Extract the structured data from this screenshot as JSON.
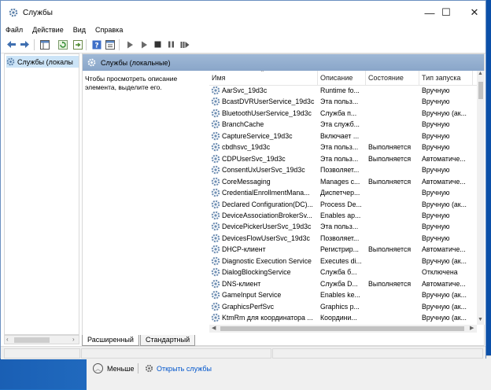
{
  "window": {
    "title": "Службы",
    "minimize": "—",
    "maximize": "☐",
    "close": "✕"
  },
  "menu": [
    "Файл",
    "Действие",
    "Вид",
    "Справка"
  ],
  "tree": {
    "node_label": "Службы (локалы"
  },
  "pane": {
    "header": "Службы (локальные)",
    "description": "Чтобы просмотреть описание элемента, выделите его.",
    "columns": {
      "name": "Имя",
      "description": "Описание",
      "status": "Состояние",
      "startup": "Тип запуска"
    }
  },
  "services": [
    {
      "name": "AarSvc_19d3c",
      "description": "Runtime fo...",
      "status": "",
      "startup": "Вручную"
    },
    {
      "name": "BcastDVRUserService_19d3c",
      "description": "Эта польз...",
      "status": "",
      "startup": "Вручную"
    },
    {
      "name": "BluetoothUserService_19d3c",
      "description": "Служба п...",
      "status": "",
      "startup": "Вручную (ак..."
    },
    {
      "name": "BranchCache",
      "description": "Эта служб...",
      "status": "",
      "startup": "Вручную"
    },
    {
      "name": "CaptureService_19d3c",
      "description": "Включает ...",
      "status": "",
      "startup": "Вручную"
    },
    {
      "name": "cbdhsvc_19d3c",
      "description": "Эта польз...",
      "status": "Выполняется",
      "startup": "Вручную"
    },
    {
      "name": "CDPUserSvc_19d3c",
      "description": "Эта польз...",
      "status": "Выполняется",
      "startup": "Автоматиче..."
    },
    {
      "name": "ConsentUxUserSvc_19d3c",
      "description": "Позволяет...",
      "status": "",
      "startup": "Вручную"
    },
    {
      "name": "CoreMessaging",
      "description": "Manages c...",
      "status": "Выполняется",
      "startup": "Автоматиче..."
    },
    {
      "name": "CredentialEnrollmentMana...",
      "description": "Диспетчер...",
      "status": "",
      "startup": "Вручную"
    },
    {
      "name": "Declared Configuration(DC)...",
      "description": "Process De...",
      "status": "",
      "startup": "Вручную (ак..."
    },
    {
      "name": "DeviceAssociationBrokerSv...",
      "description": "Enables ap...",
      "status": "",
      "startup": "Вручную"
    },
    {
      "name": "DevicePickerUserSvc_19d3c",
      "description": "Эта польз...",
      "status": "",
      "startup": "Вручную"
    },
    {
      "name": "DevicesFlowUserSvc_19d3c",
      "description": "Позволяет...",
      "status": "",
      "startup": "Вручную"
    },
    {
      "name": "DHCP-клиент",
      "description": "Регистрир...",
      "status": "Выполняется",
      "startup": "Автоматиче..."
    },
    {
      "name": "Diagnostic Execution Service",
      "description": "Executes di...",
      "status": "",
      "startup": "Вручную (ак..."
    },
    {
      "name": "DialogBlockingService",
      "description": "Служба б...",
      "status": "",
      "startup": "Отключена"
    },
    {
      "name": "DNS-клиент",
      "description": "Служба D...",
      "status": "Выполняется",
      "startup": "Автоматиче..."
    },
    {
      "name": "GameInput Service",
      "description": "Enables ke...",
      "status": "",
      "startup": "Вручную (ак..."
    },
    {
      "name": "GraphicsPerfSvc",
      "description": "Graphics p...",
      "status": "",
      "startup": "Вручную (ак..."
    },
    {
      "name": "KtmRm для координатора ...",
      "description": "Координи...",
      "status": "",
      "startup": "Вручную (ак..."
    }
  ],
  "tabs": {
    "extended": "Расширенный",
    "standard": "Стандартный"
  },
  "back_dialog": {
    "fewer": "Меньше",
    "open_services": "Открыть службы"
  }
}
